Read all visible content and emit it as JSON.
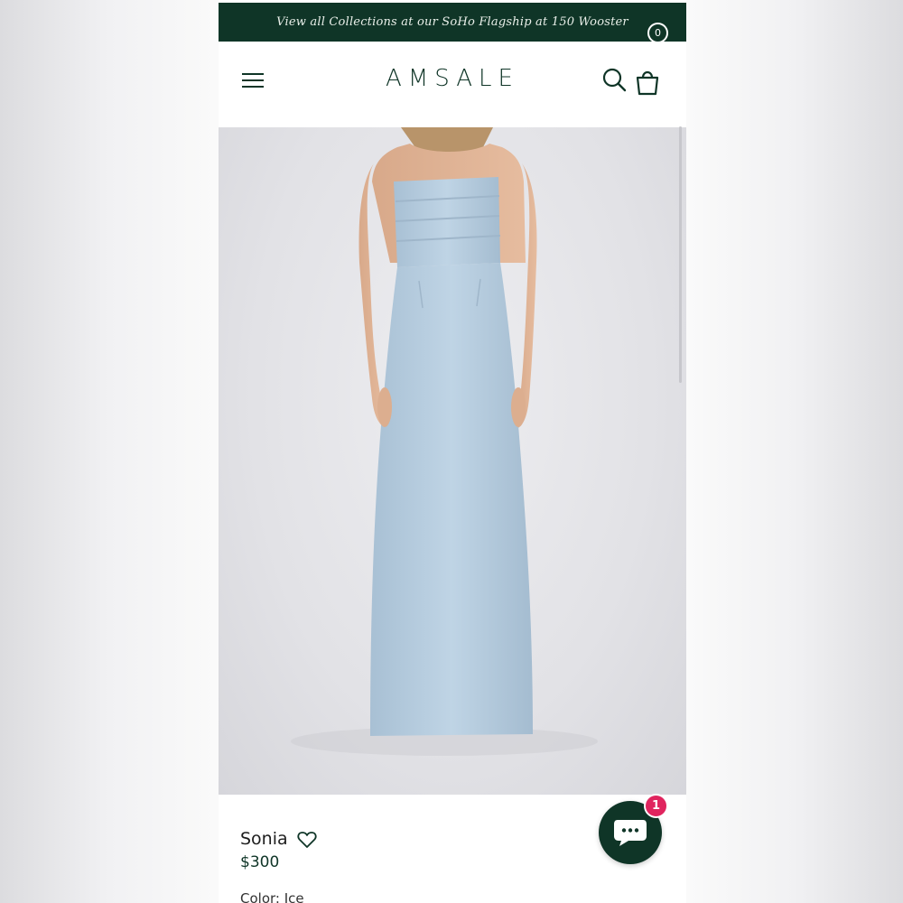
{
  "announcement": {
    "text": "View all Collections at our SoHo Flagship at 150 Wooster"
  },
  "header": {
    "brand": "AMSALE",
    "cart_count": "0",
    "icons": {
      "menu": "hamburger-menu-icon",
      "search": "search-icon",
      "cart": "shopping-bag-icon"
    }
  },
  "product": {
    "name": "Sonia",
    "price": "$300",
    "color_label": "Color: Ice",
    "image": "model-wearing-ice-blue-strapless-gown"
  },
  "chat": {
    "badge_count": "1",
    "icon": "chat-bubble-icon"
  },
  "colors": {
    "brand_green": "#0f3527",
    "badge_red": "#e0245e",
    "dress_blue": "#b9cfe0"
  }
}
